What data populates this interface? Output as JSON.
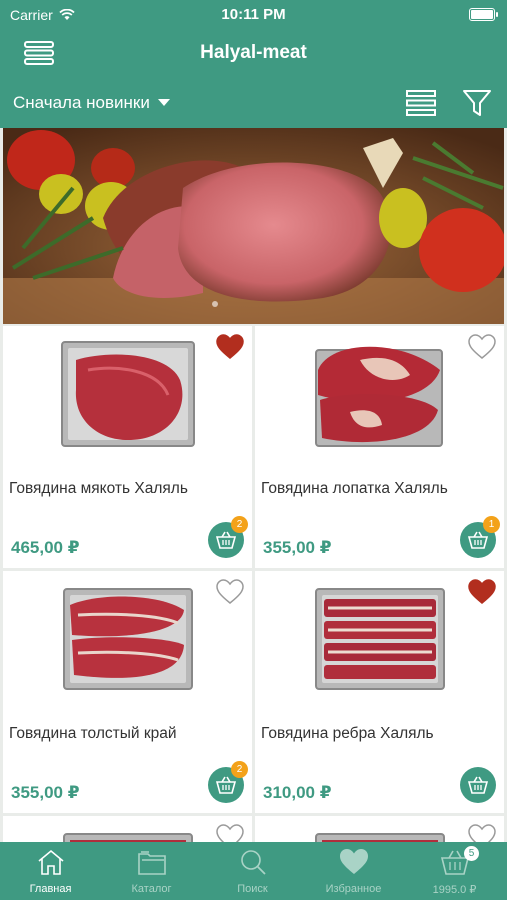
{
  "status": {
    "carrier": "Carrier",
    "time": "10:11 PM"
  },
  "header": {
    "title": "Halyal-meat"
  },
  "sort": {
    "label": "Сначала новинки"
  },
  "products": [
    {
      "name": "Говядина мякоть Халяль",
      "price": "465,00 ₽",
      "favorite": true,
      "cart_count": "2"
    },
    {
      "name": "Говядина лопатка Халяль",
      "price": "355,00 ₽",
      "favorite": false,
      "cart_count": "1"
    },
    {
      "name": "Говядина толстый край",
      "price": "355,00 ₽",
      "favorite": false,
      "cart_count": "2"
    },
    {
      "name": "Говядина ребра Халяль",
      "price": "310,00 ₽",
      "favorite": true,
      "cart_count": ""
    }
  ],
  "tabs": [
    {
      "label": "Главная",
      "icon": "home-icon"
    },
    {
      "label": "Каталог",
      "icon": "folder-icon"
    },
    {
      "label": "Поиск",
      "icon": "search-icon"
    },
    {
      "label": "Избранное",
      "icon": "heart-icon"
    },
    {
      "label": "1995.0 ₽",
      "icon": "basket-icon",
      "badge": "5"
    }
  ],
  "colors": {
    "primary": "#3f9a82",
    "badge": "#f3a21a",
    "favorite": "#b22e1e"
  }
}
